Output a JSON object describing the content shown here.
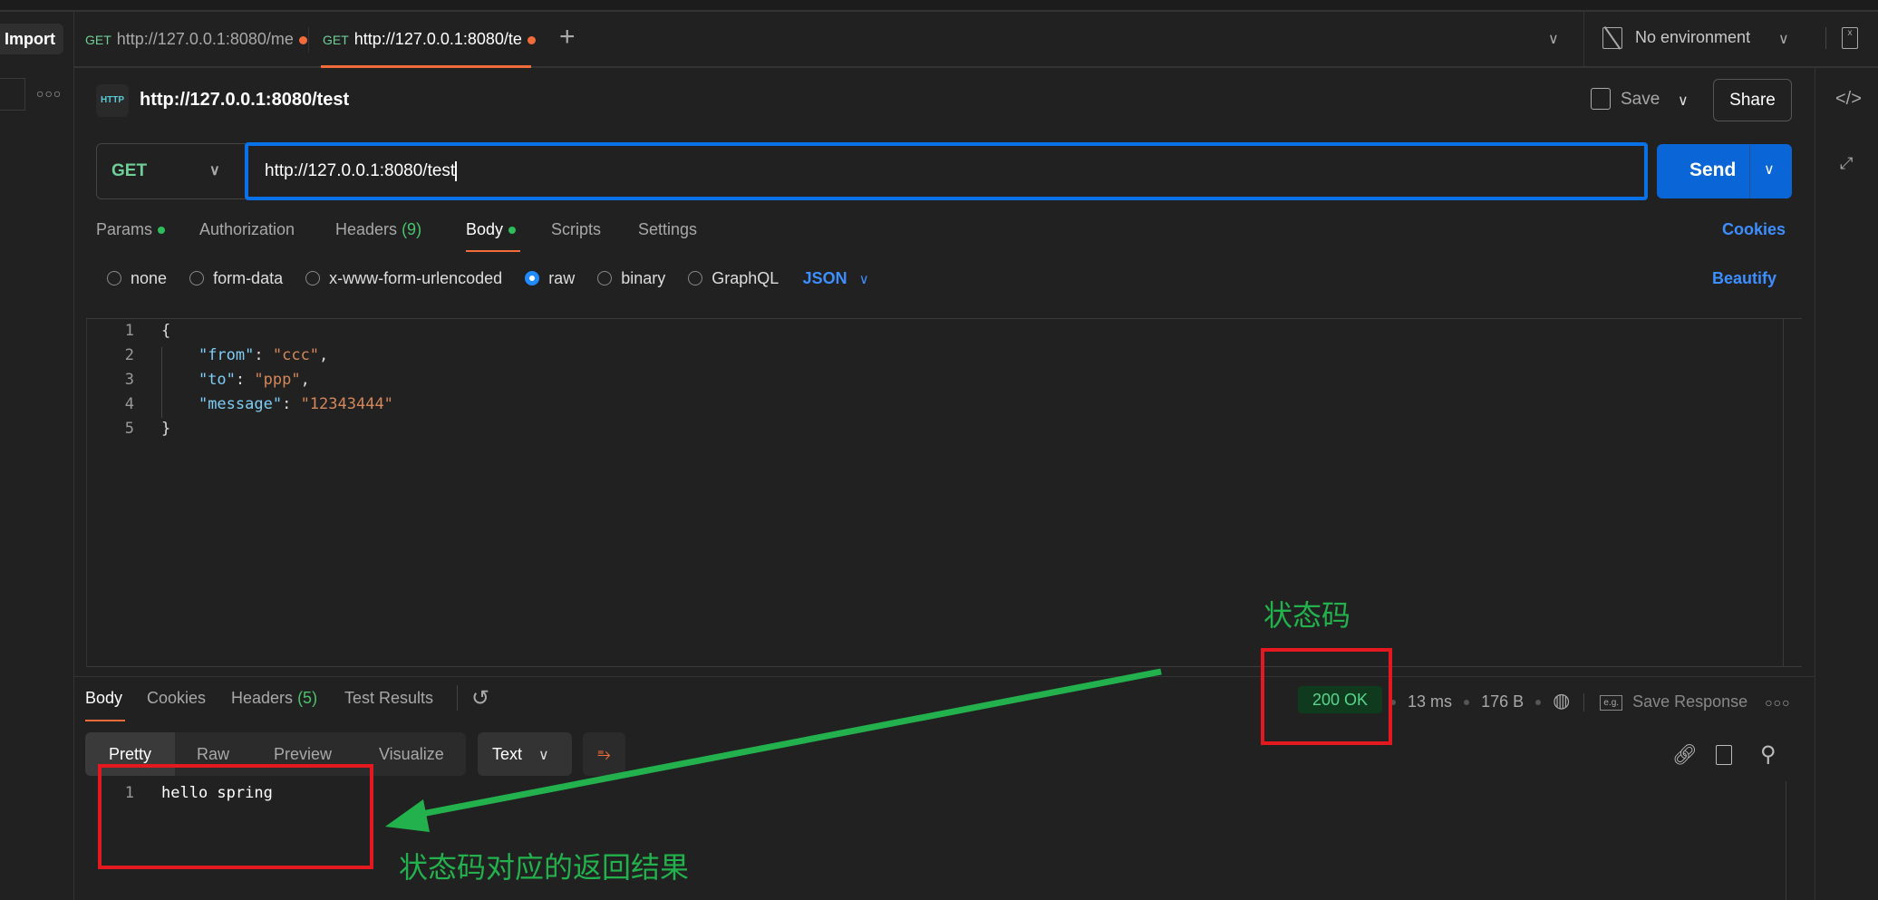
{
  "sidebar": {
    "import_label": "Import",
    "more_icon": "ellipsis-icon"
  },
  "tabs": [
    {
      "method": "GET",
      "label": "http://127.0.0.1:8080/me",
      "unsaved": true
    },
    {
      "method": "GET",
      "label": "http://127.0.0.1:8080/te",
      "unsaved": true,
      "active": true
    }
  ],
  "environment": {
    "label": "No environment"
  },
  "request": {
    "title": "http://127.0.0.1:8080/test",
    "save_label": "Save",
    "share_label": "Share",
    "method": "GET",
    "url": "http://127.0.0.1:8080/test",
    "send_label": "Send",
    "tabs": {
      "params": "Params",
      "authorization": "Authorization",
      "headers": "Headers",
      "headers_count": "(9)",
      "body": "Body",
      "scripts": "Scripts",
      "settings": "Settings"
    },
    "cookies_label": "Cookies",
    "body_types": [
      "none",
      "form-data",
      "x-www-form-urlencoded",
      "raw",
      "binary",
      "GraphQL"
    ],
    "selected_body_type": "raw",
    "format": "JSON",
    "beautify_label": "Beautify",
    "body_lines": [
      "{",
      "    \"from\": \"ccc\",",
      "    \"to\": \"ppp\",",
      "    \"message\": \"12343444\"",
      "}"
    ]
  },
  "response": {
    "tabs": {
      "body": "Body",
      "cookies": "Cookies",
      "headers": "Headers",
      "headers_count": "(5)",
      "test_results": "Test Results"
    },
    "status": "200 OK",
    "time": "13 ms",
    "size": "176 B",
    "save_label": "Save Response",
    "views": [
      "Pretty",
      "Raw",
      "Preview",
      "Visualize"
    ],
    "selected_view": "Pretty",
    "format": "Text",
    "lines": [
      "hello spring"
    ]
  },
  "annotations": {
    "status_label": "状态码",
    "result_label": "状态码对应的返回结果"
  },
  "colors": {
    "accent": "#f26b3a",
    "send": "#0a66d6",
    "method_get": "#6fcf97",
    "annotation_green": "#22b14c",
    "annotation_red": "#e3191f"
  }
}
